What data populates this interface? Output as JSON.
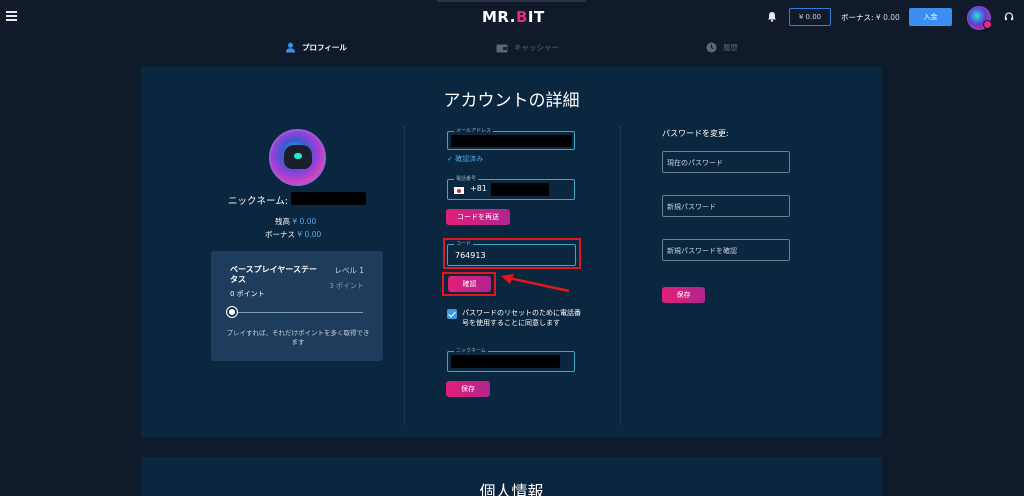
{
  "header": {
    "logo_left": "MR.",
    "logo_b": "B",
    "logo_right": "IT",
    "balance": "¥ 0.00",
    "bonus_label": "ボーナス:",
    "bonus_value": "¥ 0.00",
    "deposit_label": "入金",
    "icons": [
      "menu-icon",
      "bell-icon",
      "avatar",
      "headset-icon"
    ]
  },
  "tabs": [
    {
      "label": "プロフィール",
      "icon": "user-icon",
      "active": true
    },
    {
      "label": "キャッシャー",
      "icon": "wallet-icon",
      "active": false
    },
    {
      "label": "履歴",
      "icon": "clock-icon",
      "active": false
    }
  ],
  "account": {
    "title": "アカウントの詳細",
    "nickname_label": "ニックネーム:",
    "balance_label": "残高",
    "balance_value": "¥ 0.00",
    "bonus_label": "ボーナス",
    "bonus_value": "¥ 0.00",
    "status": {
      "title": "ベースプレイヤーステータス",
      "level": "レベル 1",
      "points": "0 ポイント",
      "next_points": "3 ポイント",
      "progress": 0,
      "hint": "プレイすれば、それだけポイントを多く取得できます"
    }
  },
  "contact": {
    "email_label": "メールアドレス",
    "verified": "確認済み",
    "phone_label": "電話番号",
    "phone_code": "+81",
    "resend_button": "コードを再送",
    "code_label": "コード",
    "code_value": "764913",
    "confirm_button": "確認",
    "checkbox_label": "パスワードのリセットのために電話番号を使用することに同意します",
    "nickname_label": "ニックネーム",
    "save_button": "保存"
  },
  "password": {
    "title": "パスワードを変更:",
    "current_placeholder": "現在のパスワード",
    "new_placeholder": "新規パスワード",
    "confirm_placeholder": "新規パスワードを確認",
    "save_button": "保存"
  },
  "personal": {
    "title": "個人情報"
  },
  "colors": {
    "background": "#0f1a2a",
    "panel": "#0b2740",
    "accent_pink": "#e11f77",
    "accent_blue": "#3a8ff0",
    "field_border": "#3ea6c7",
    "highlight_red": "#e0171d"
  }
}
